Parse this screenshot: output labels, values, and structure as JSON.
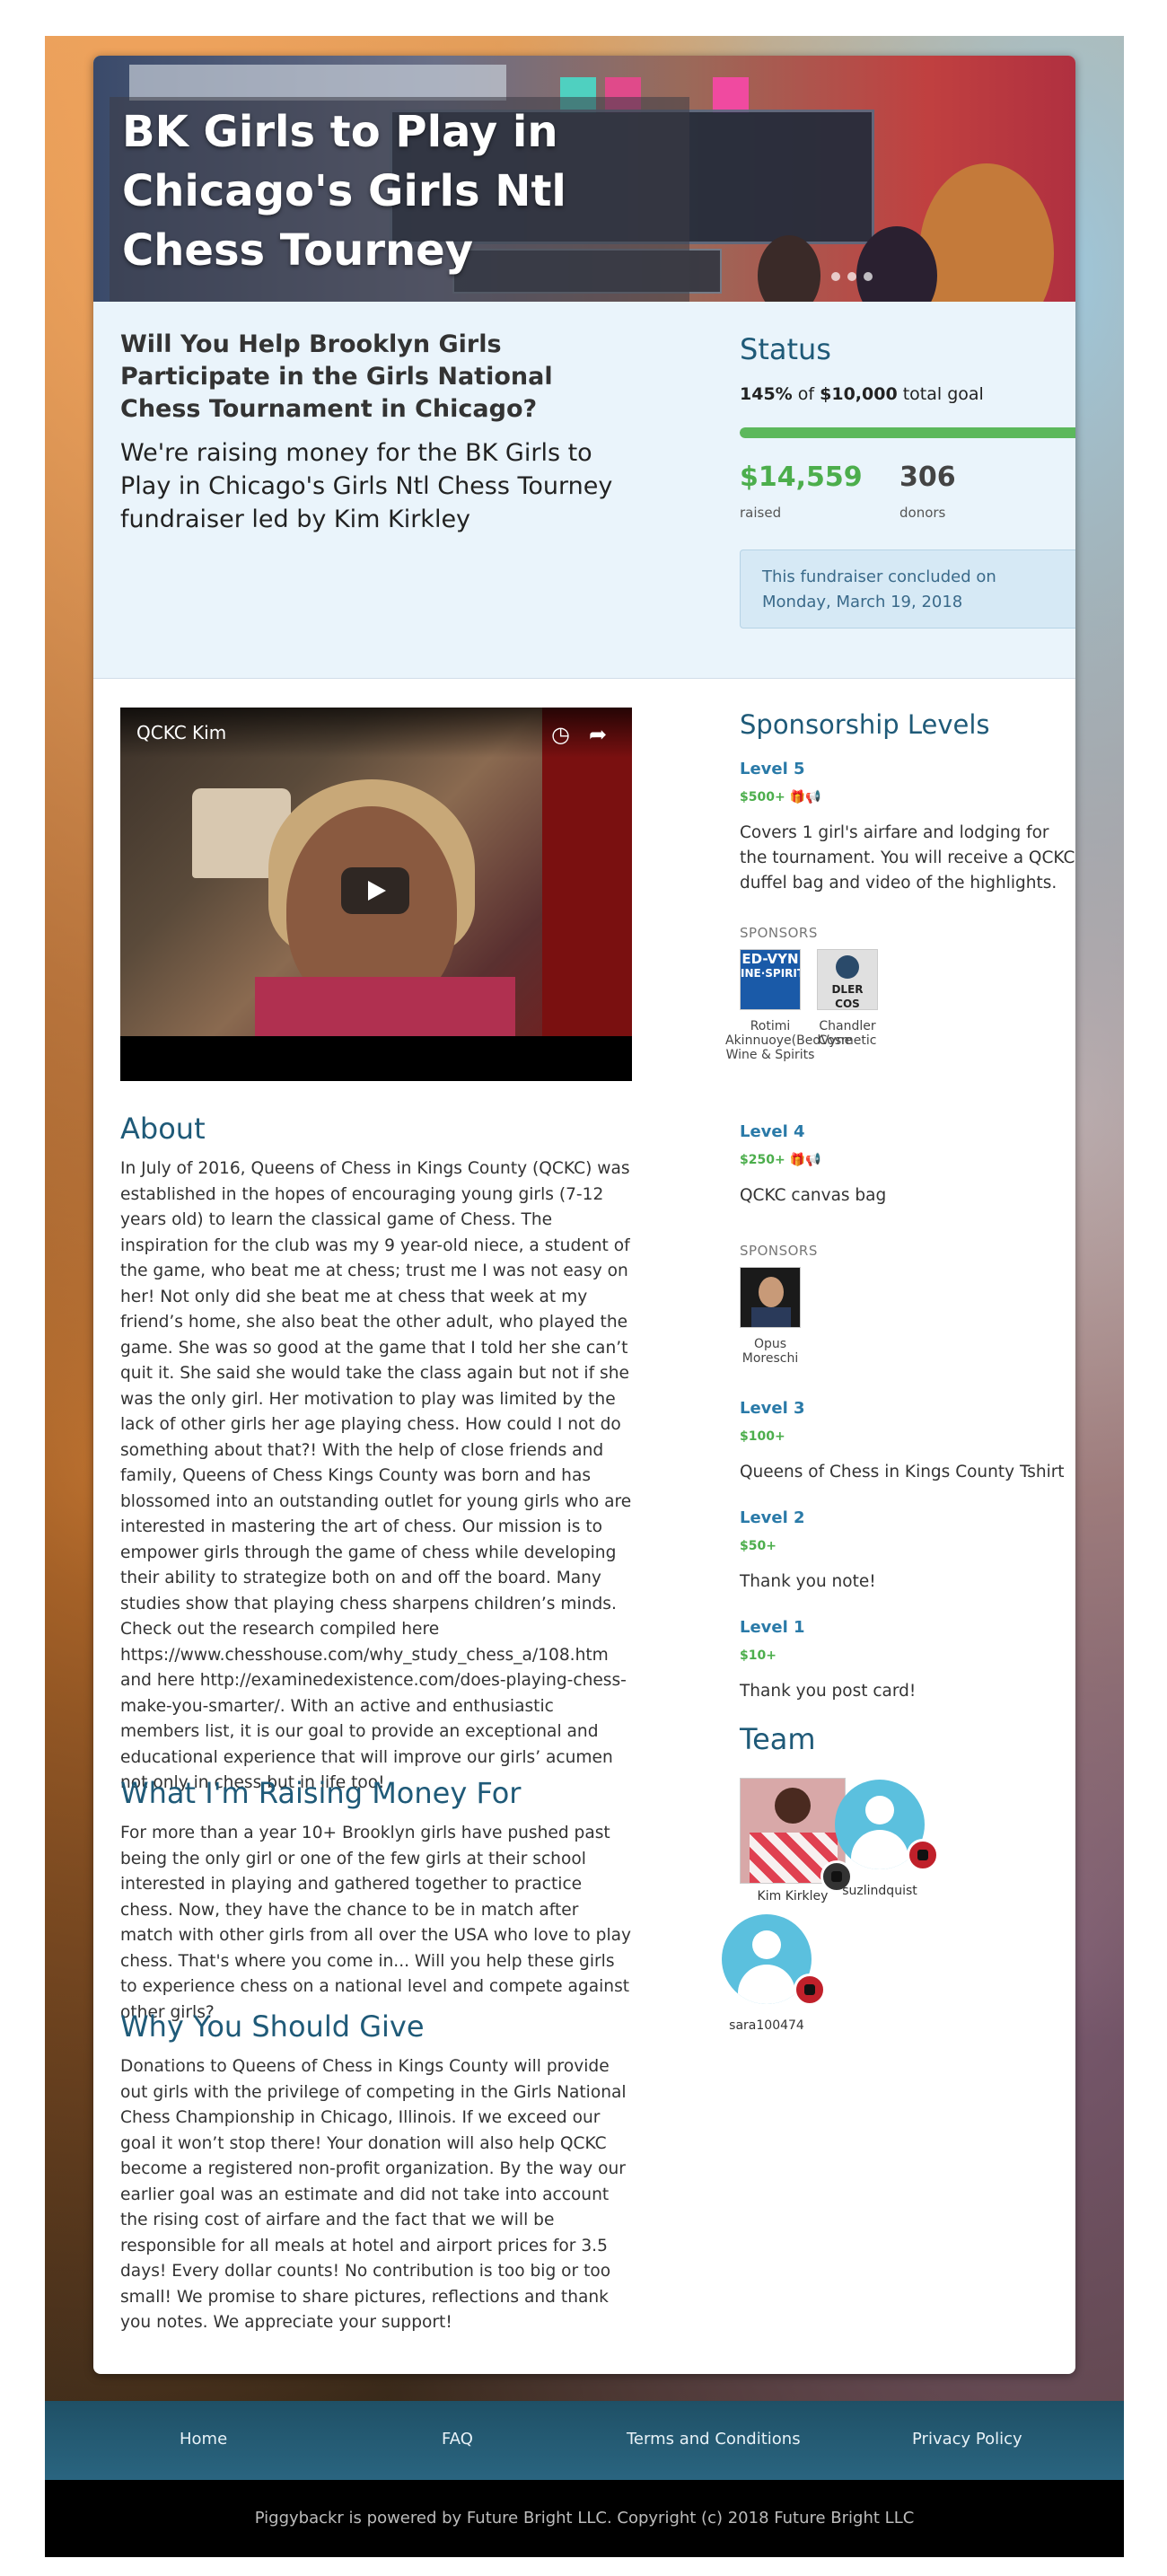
{
  "campaign": {
    "title": "BK Girls to Play in Chicago's Girls Ntl Chess Tourney",
    "question": "Will You Help Brooklyn Girls Participate in the Girls National Chess Tournament in Chicago?",
    "description": "We're raising money for the BK Girls to Play in Chicago's Girls Ntl Chess Tourney fundraiser led by Kim Kirkley"
  },
  "status": {
    "heading": "Status",
    "percent": "145%",
    "goal_of": "of",
    "goal_amount": "$10,000",
    "goal_suffix": "total goal",
    "progress_fraction": 1.0,
    "raised_value": "$14,559",
    "raised_label": "raised",
    "donors_value": "306",
    "donors_label": "donors",
    "concluded": "This fundraiser concluded on Monday, March 19, 2018"
  },
  "video": {
    "title": "QCKC Kim"
  },
  "about": {
    "heading": "About",
    "text": "In July of 2016, Queens of Chess in Kings County (QCKC) was established in the hopes of encouraging young girls (7-12 years old) to learn the classical game of Chess. The inspiration for the club was my 9 year-old niece, a student of the game, who beat me at chess; trust me I was not easy on her! Not only did she beat me at chess that week at my friend’s home, she also beat the other adult, who played the game. She was so good at the game that I told her she can’t quit it. She said she would take the class again but not if she was the only girl. Her motivation to play was limited by the lack of other girls her age playing chess. How could I not do something about that?! With the help of close friends and family, Queens of Chess Kings County was born and has blossomed into an outstanding outlet for young girls who are interested in mastering the art of chess. Our mission is to empower girls through the game of chess while developing their ability to strategize both on and off the board. Many studies show that playing chess sharpens children’s minds. Check out the research compiled here https://www.chesshouse.com/why_study_chess_a/108.htm and here http://examinedexistence.com/does-playing-chess-make-you-smarter/. With an active and enthusiastic members list, it is our goal to provide an exceptional and educational experience that will improve our girls’ acumen not only in chess but in life too!"
  },
  "raising": {
    "heading": "What I'm Raising Money For",
    "text": "For more than a year 10+ Brooklyn girls have pushed past being the only girl or one of the few girls at their school interested in playing and gathered together to practice chess. Now, they have the chance to be in match after match with other girls from all over the USA who love to play chess. That's where you come in... Will you help these girls to experience chess on a national level and compete against other girls?"
  },
  "why": {
    "heading": "Why You Should Give",
    "text": "Donations to Queens of Chess in Kings County will provide out girls with the privilege of competing in the Girls National Chess Championship in Chicago, Illinois. If we exceed our goal it won’t stop there! Your donation will also help QCKC become a registered non-profit organization. By the way our earlier goal was an estimate and did not take into account the rising cost of airfare and the fact that we will be responsible for all meals at hotel and airport prices for 3.5 days! Every dollar counts! No contribution is too big or too small! We promise to share pictures, reflections and thank you notes. We appreciate your support!"
  },
  "sponsorship": {
    "heading": "Sponsorship Levels",
    "sponsors_label": "SPONSORS",
    "levels": [
      {
        "name": "Level 5",
        "price": "$500+",
        "desc": "Covers 1 girl's airfare and lodging for the tournament. You will receive a QCKC duffel bag and video of the highlights."
      },
      {
        "name": "Level 4",
        "price": "$250+",
        "desc": "QCKC canvas bag"
      },
      {
        "name": "Level 3",
        "price": "$100+",
        "desc": "Queens of Chess in Kings County Tshirt"
      },
      {
        "name": "Level 2",
        "price": "$50+",
        "desc": "Thank you note!"
      },
      {
        "name": "Level 1",
        "price": "$10+",
        "desc": "Thank you post card!"
      }
    ],
    "level5_sponsors": [
      {
        "name": "Rotimi Akinnuoye(BedVyne Wine & Spirits",
        "logo_text_1": "ED-VYN",
        "logo_text_2": "INE·SPIRIT"
      },
      {
        "name": "Chandler Cosmetic",
        "logo_text_1": "DLER COS"
      }
    ],
    "level4_sponsors": [
      {
        "name": "Opus Moreschi"
      }
    ]
  },
  "team": {
    "heading": "Team",
    "members": [
      {
        "name": "Kim Kirkley"
      },
      {
        "name": "suzlindquist"
      },
      {
        "name": "sara100474"
      }
    ]
  },
  "footer": {
    "links": [
      "Home",
      "FAQ",
      "Terms and Conditions",
      "Privacy Policy"
    ],
    "copyright": "Piggybackr is powered by Future Bright LLC. Copyright (c) 2018 Future Bright LLC"
  },
  "icons": {
    "video_clock": "clock-icon",
    "video_share": "share-icon",
    "level_perks": "gift-megaphone-icons"
  },
  "colors": {
    "accent": "#1f5a78",
    "link": "#2a7aa8",
    "money": "#4cae4c",
    "panel": "#eaf4fb",
    "footer": "#1f5066"
  }
}
